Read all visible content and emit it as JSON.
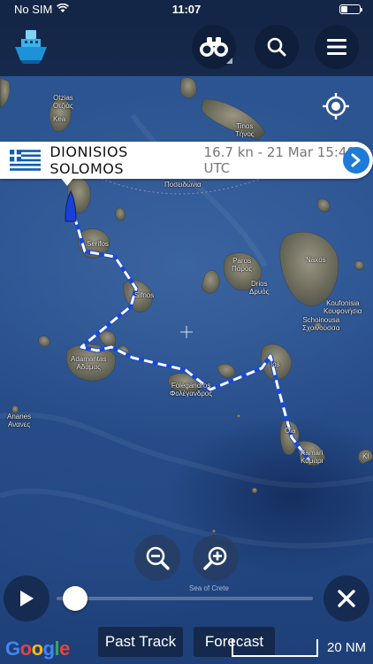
{
  "status_bar": {
    "carrier": "No SIM",
    "time": "11:07",
    "battery_level": 0.35
  },
  "nav": {
    "logo_icon": "ship-logo-icon",
    "binoculars_icon": "binoculars-icon",
    "search_icon": "search-icon",
    "menu_icon": "hamburger-menu-icon"
  },
  "vessel": {
    "name": "DIONISIOS SOLOMOS",
    "info": "16.7 kn - 21 Mar 15:48 UTC",
    "flag": "greece-flag-icon",
    "flag_colors": {
      "blue": "#0d5eaf",
      "white": "#ffffff"
    },
    "track_color": "#ffffff",
    "vessel_color": "#1a3fd6"
  },
  "map_labels": {
    "otzias": "Otzias\nΟτζιάς",
    "kea": "Kea",
    "tinos": "Tinos\nΤήνος",
    "poseidonia": "Ποσειδώνια",
    "serifos": "Serifos",
    "paros": "Paros\nΠάρος",
    "naxos": "Naxos",
    "drios": "Drios\nΔρυός",
    "sifnos": "Sifnos",
    "koufonisia": "Koufonisia\nΚουφονήσια",
    "schoinousa": "Schoinousa\nΣχοινούσσα",
    "adamantas": "Adamantas\nΑδάμας",
    "folegandros": "Folegandros\nΦολέγανδρος",
    "ios": "Ios",
    "anafi": "Ανάφη",
    "oia": "Oia",
    "kamari": "Kamari\nΚαμάρι",
    "anafi2": "Kl",
    "ananes": "Ananes\nΑνανες",
    "sea_of_crete": "Sea of Crete"
  },
  "controls": {
    "zoom_out_icon": "zoom-out-icon",
    "zoom_in_icon": "zoom-in-icon",
    "play_icon": "play-icon",
    "close_icon": "close-icon",
    "locate_icon": "locate-icon",
    "timeline_progress": 0.02
  },
  "bottom": {
    "google": "Google",
    "past_track": "Past Track",
    "forecast": "Forecast",
    "scale": "20 NM"
  }
}
